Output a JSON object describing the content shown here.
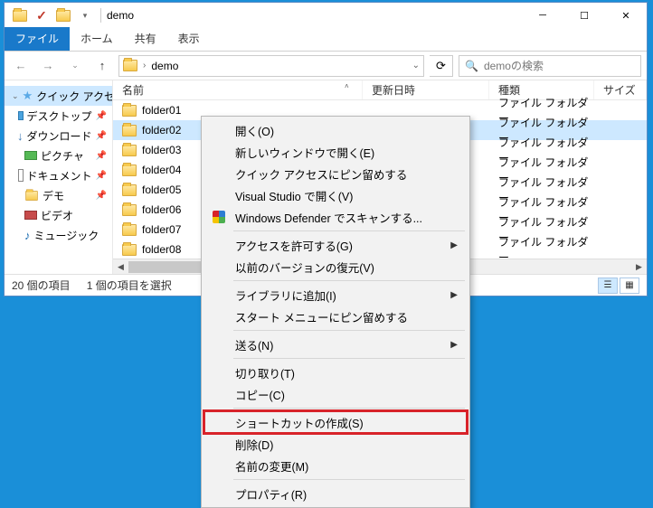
{
  "window": {
    "title": "demo",
    "min": "─",
    "max": "☐",
    "close": "✕"
  },
  "tabs": {
    "file": "ファイル",
    "home": "ホーム",
    "share": "共有",
    "view": "表示"
  },
  "address": {
    "folder": "demo",
    "dropdown": "⌄",
    "refresh": "⟳"
  },
  "search": {
    "placeholder": "demoの検索",
    "icon": "🔍"
  },
  "nav_items": [
    {
      "label": "クイック アクセス",
      "icon": "star",
      "expand": "⌄",
      "sel": true
    },
    {
      "label": "デスクトップ",
      "icon": "desk",
      "pin": true
    },
    {
      "label": "ダウンロード",
      "icon": "dl",
      "pin": true
    },
    {
      "label": "ピクチャ",
      "icon": "pic",
      "pin": true
    },
    {
      "label": "ドキュメント",
      "icon": "doc",
      "pin": true
    },
    {
      "label": "デモ",
      "icon": "folder",
      "pin": true
    },
    {
      "label": "ビデオ",
      "icon": "vid",
      "pin": false
    },
    {
      "label": "ミュージック",
      "icon": "music",
      "pin": false
    }
  ],
  "columns": {
    "name": "名前",
    "date": "更新日時",
    "type": "種類",
    "size": "サイズ"
  },
  "files": [
    {
      "name": "folder01",
      "type": "ファイル フォルダー",
      "sel": false
    },
    {
      "name": "folder02",
      "type": "ファイル フォルダー",
      "sel": true
    },
    {
      "name": "folder03",
      "type": "ファイル フォルダー",
      "sel": false
    },
    {
      "name": "folder04",
      "type": "ファイル フォルダー",
      "sel": false
    },
    {
      "name": "folder05",
      "type": "ファイル フォルダー",
      "sel": false
    },
    {
      "name": "folder06",
      "type": "ファイル フォルダー",
      "sel": false
    },
    {
      "name": "folder07",
      "type": "ファイル フォルダー",
      "sel": false
    },
    {
      "name": "folder08",
      "type": "ファイル フォルダー",
      "sel": false
    }
  ],
  "status": {
    "count": "20 個の項目",
    "selected": "1 個の項目を選択"
  },
  "context_menu": [
    {
      "label": "開く(O)",
      "type": "item"
    },
    {
      "label": "新しいウィンドウで開く(E)",
      "type": "item"
    },
    {
      "label": "クイック アクセスにピン留めする",
      "type": "item"
    },
    {
      "label": "Visual Studio で開く(V)",
      "type": "item"
    },
    {
      "label": "Windows Defender でスキャンする...",
      "type": "item",
      "icon": "shield"
    },
    {
      "type": "sep"
    },
    {
      "label": "アクセスを許可する(G)",
      "type": "sub"
    },
    {
      "label": "以前のバージョンの復元(V)",
      "type": "item"
    },
    {
      "type": "sep"
    },
    {
      "label": "ライブラリに追加(I)",
      "type": "sub"
    },
    {
      "label": "スタート メニューにピン留めする",
      "type": "item"
    },
    {
      "type": "sep"
    },
    {
      "label": "送る(N)",
      "type": "sub"
    },
    {
      "type": "sep"
    },
    {
      "label": "切り取り(T)",
      "type": "item"
    },
    {
      "label": "コピー(C)",
      "type": "item"
    },
    {
      "type": "sep"
    },
    {
      "label": "ショートカットの作成(S)",
      "type": "item",
      "highlight": true
    },
    {
      "label": "削除(D)",
      "type": "item"
    },
    {
      "label": "名前の変更(M)",
      "type": "item"
    },
    {
      "type": "sep"
    },
    {
      "label": "プロパティ(R)",
      "type": "item"
    }
  ]
}
